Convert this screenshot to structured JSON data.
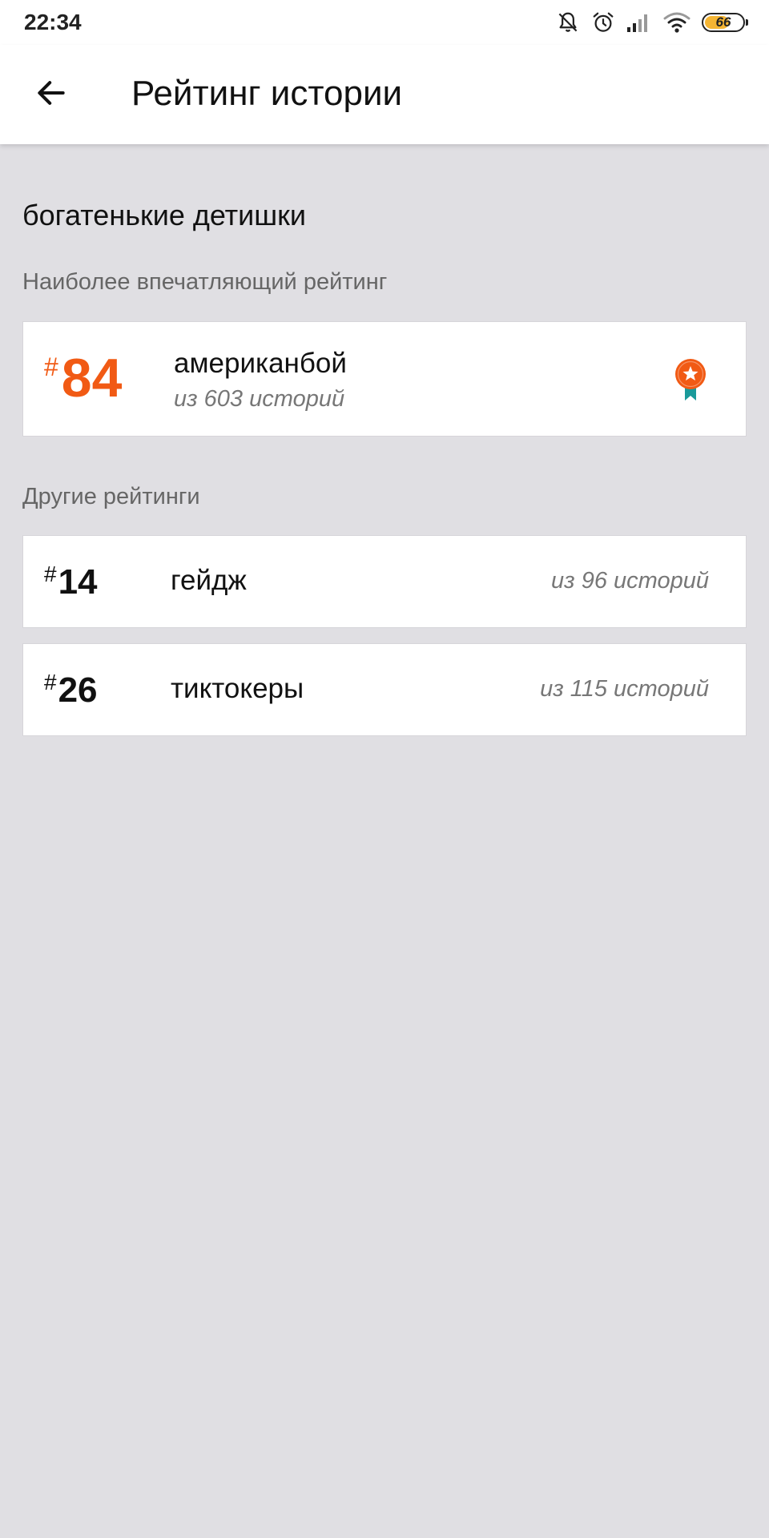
{
  "status_bar": {
    "time": "22:34",
    "battery": "66",
    "battery_fill_fraction": 0.66,
    "icons": [
      "bell-off-icon",
      "alarm-icon",
      "signal-icon",
      "wifi-icon",
      "battery-icon"
    ]
  },
  "app_bar": {
    "back_icon": "arrow-left-icon",
    "title": "Рейтинг истории"
  },
  "story": {
    "title": "богатенькие детишки"
  },
  "best_section": {
    "label": "Наиболее впечатляющий рейтинг",
    "item": {
      "hash": "#",
      "rank": "84",
      "tag": "американбой",
      "count": "из 603 историй",
      "badge_icon": "medal-icon"
    }
  },
  "other_section": {
    "label": "Другие рейтинги",
    "items": [
      {
        "hash": "#",
        "rank": "14",
        "tag": "гейдж",
        "count": "из 96 историй"
      },
      {
        "hash": "#",
        "rank": "26",
        "tag": "тиктокеры",
        "count": "из 115 историй"
      }
    ]
  },
  "colors": {
    "accent": "#f15a14",
    "battery_fill": "#f5b533",
    "medal_ribbon": "#1a9a9a",
    "background": "#e0dfe3"
  }
}
